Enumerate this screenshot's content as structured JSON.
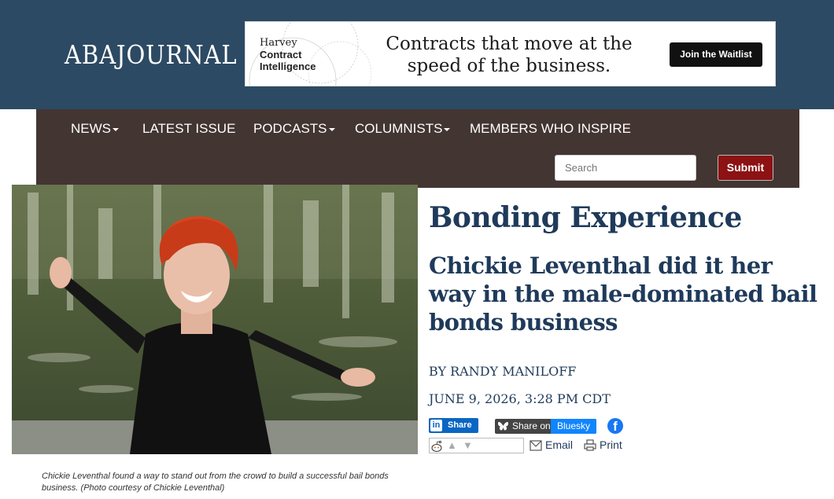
{
  "header": {
    "logo_text": "ABAJOURNAL",
    "ad": {
      "brand_line1": "Harvey",
      "brand_line2": "Contract",
      "brand_line3": "Intelligence",
      "headline": "Contracts that move at the speed of the business.",
      "cta": "Join the Waitlist"
    }
  },
  "nav": {
    "items": [
      {
        "label": "NEWS",
        "dropdown": true
      },
      {
        "label": "LATEST ISSUE",
        "dropdown": false
      },
      {
        "label": "PODCASTS",
        "dropdown": true
      },
      {
        "label": "COLUMNISTS",
        "dropdown": true
      },
      {
        "label": "MEMBERS WHO INSPIRE",
        "dropdown": false
      }
    ],
    "search_placeholder": "Search",
    "submit_label": "Submit"
  },
  "article": {
    "kicker": "Bonding Experience",
    "headline": "Chickie Leventhal did it her way in the male-dominated bail bonds business",
    "byline": "BY RANDY MANILOFF",
    "dateline": "JUNE 9, 2026, 3:28 PM CDT",
    "caption": "Chickie Leventhal found a way to stand out from the crowd to build a successful bail bonds business. (Photo courtesy of Chickie Leventhal)"
  },
  "share": {
    "linkedin_label": "Share",
    "linkedin_glyph": "in",
    "bluesky_left": "Share on",
    "bluesky_right": "Bluesky",
    "facebook_glyph": "f",
    "email_label": "Email",
    "print_label": "Print"
  },
  "colors": {
    "header_bg": "#2c4a63",
    "nav_bg": "#433532",
    "submit_bg": "#8c1214",
    "headline": "#1f3a5a",
    "linkedin": "#0a66c2",
    "bluesky": "#1185fe",
    "facebook": "#1877f2"
  },
  "icons": [
    "linkedin-icon",
    "bluesky-butterfly-icon",
    "facebook-icon",
    "reddit-icon",
    "upvote-icon",
    "downvote-icon",
    "email-icon",
    "print-icon",
    "caret-down-icon"
  ]
}
